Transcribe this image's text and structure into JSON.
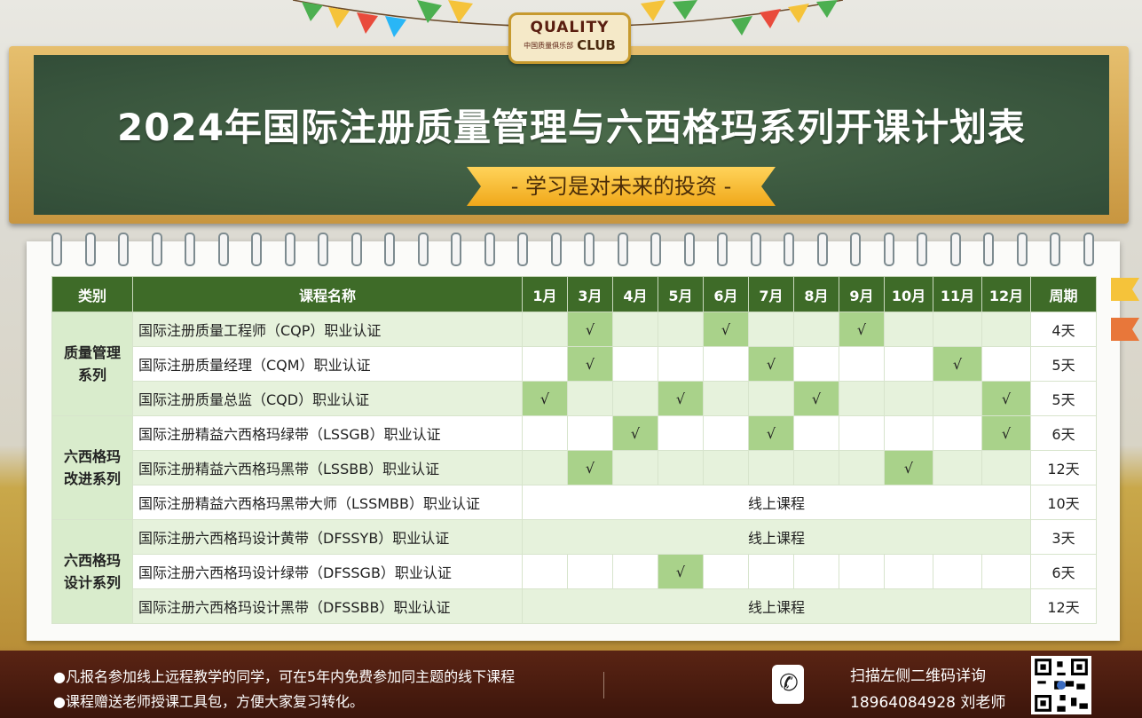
{
  "logo": {
    "top": "QUALITY",
    "cn": "中国质量俱乐部",
    "club": "CLUB"
  },
  "board": {
    "title": "2024年国际注册质量管理与六西格玛系列开课计划表",
    "slogan": "- 学习是对未来的投资 -"
  },
  "table": {
    "headers": {
      "category": "类别",
      "course": "课程名称",
      "months": [
        "1月",
        "3月",
        "4月",
        "5月",
        "6月",
        "7月",
        "8月",
        "9月",
        "10月",
        "11月",
        "12月"
      ],
      "period": "周期"
    },
    "check_mark": "√",
    "online_label": "线上课程",
    "categories": [
      "质量管理\n系列",
      "六西格玛\n改进系列",
      "六西格玛\n设计系列"
    ],
    "rows": [
      {
        "name": "国际注册质量工程师（CQP）职业认证",
        "months": [
          "",
          "√",
          "",
          "",
          "√",
          "",
          "",
          "√",
          "",
          "",
          ""
        ],
        "period": "4天",
        "online": false
      },
      {
        "name": "国际注册质量经理（CQM）职业认证",
        "months": [
          "",
          "√",
          "",
          "",
          "",
          "√",
          "",
          "",
          "",
          "√",
          ""
        ],
        "period": "5天",
        "online": false
      },
      {
        "name": "国际注册质量总监（CQD）职业认证",
        "months": [
          "√",
          "",
          "",
          "√",
          "",
          "",
          "√",
          "",
          "",
          "",
          "√"
        ],
        "period": "5天",
        "online": false
      },
      {
        "name": "国际注册精益六西格玛绿带（LSSGB）职业认证",
        "months": [
          "",
          "",
          "√",
          "",
          "",
          "√",
          "",
          "",
          "",
          "",
          "√"
        ],
        "period": "6天",
        "online": false
      },
      {
        "name": "国际注册精益六西格玛黑带（LSSBB）职业认证",
        "months": [
          "",
          "√",
          "",
          "",
          "",
          "",
          "",
          "",
          "√",
          "",
          ""
        ],
        "period": "12天",
        "online": false
      },
      {
        "name": "国际注册精益六西格玛黑带大师（LSSMBB）职业认证",
        "months": [],
        "period": "10天",
        "online": true
      },
      {
        "name": "国际注册六西格玛设计黄带（DFSSYB）职业认证",
        "months": [],
        "period": "3天",
        "online": true
      },
      {
        "name": "国际注册六西格玛设计绿带（DFSSGB）职业认证",
        "months": [
          "",
          "",
          "",
          "√",
          "",
          "",
          "",
          "",
          "",
          "",
          ""
        ],
        "period": "6天",
        "online": false
      },
      {
        "name": "国际注册六西格玛设计黑带（DFSSBB）职业认证",
        "months": [],
        "period": "12天",
        "online": true
      }
    ]
  },
  "footer": {
    "note1": "●凡报名参加线上远程教学的同学，可在5年内免费参加同主题的线下课程",
    "note2": "●课程赠送老师授课工具包，方便大家复习转化。",
    "scan": "扫描左侧二维码详询",
    "contact": "18964084928 刘老师"
  },
  "colors": {
    "header_green": "#3e6b28",
    "checked_cell": "#a9d28a",
    "category_cell": "#d9eccc",
    "board": "#324d38",
    "ribbon": "#f0a81a",
    "footer": "#4a1c0f"
  }
}
